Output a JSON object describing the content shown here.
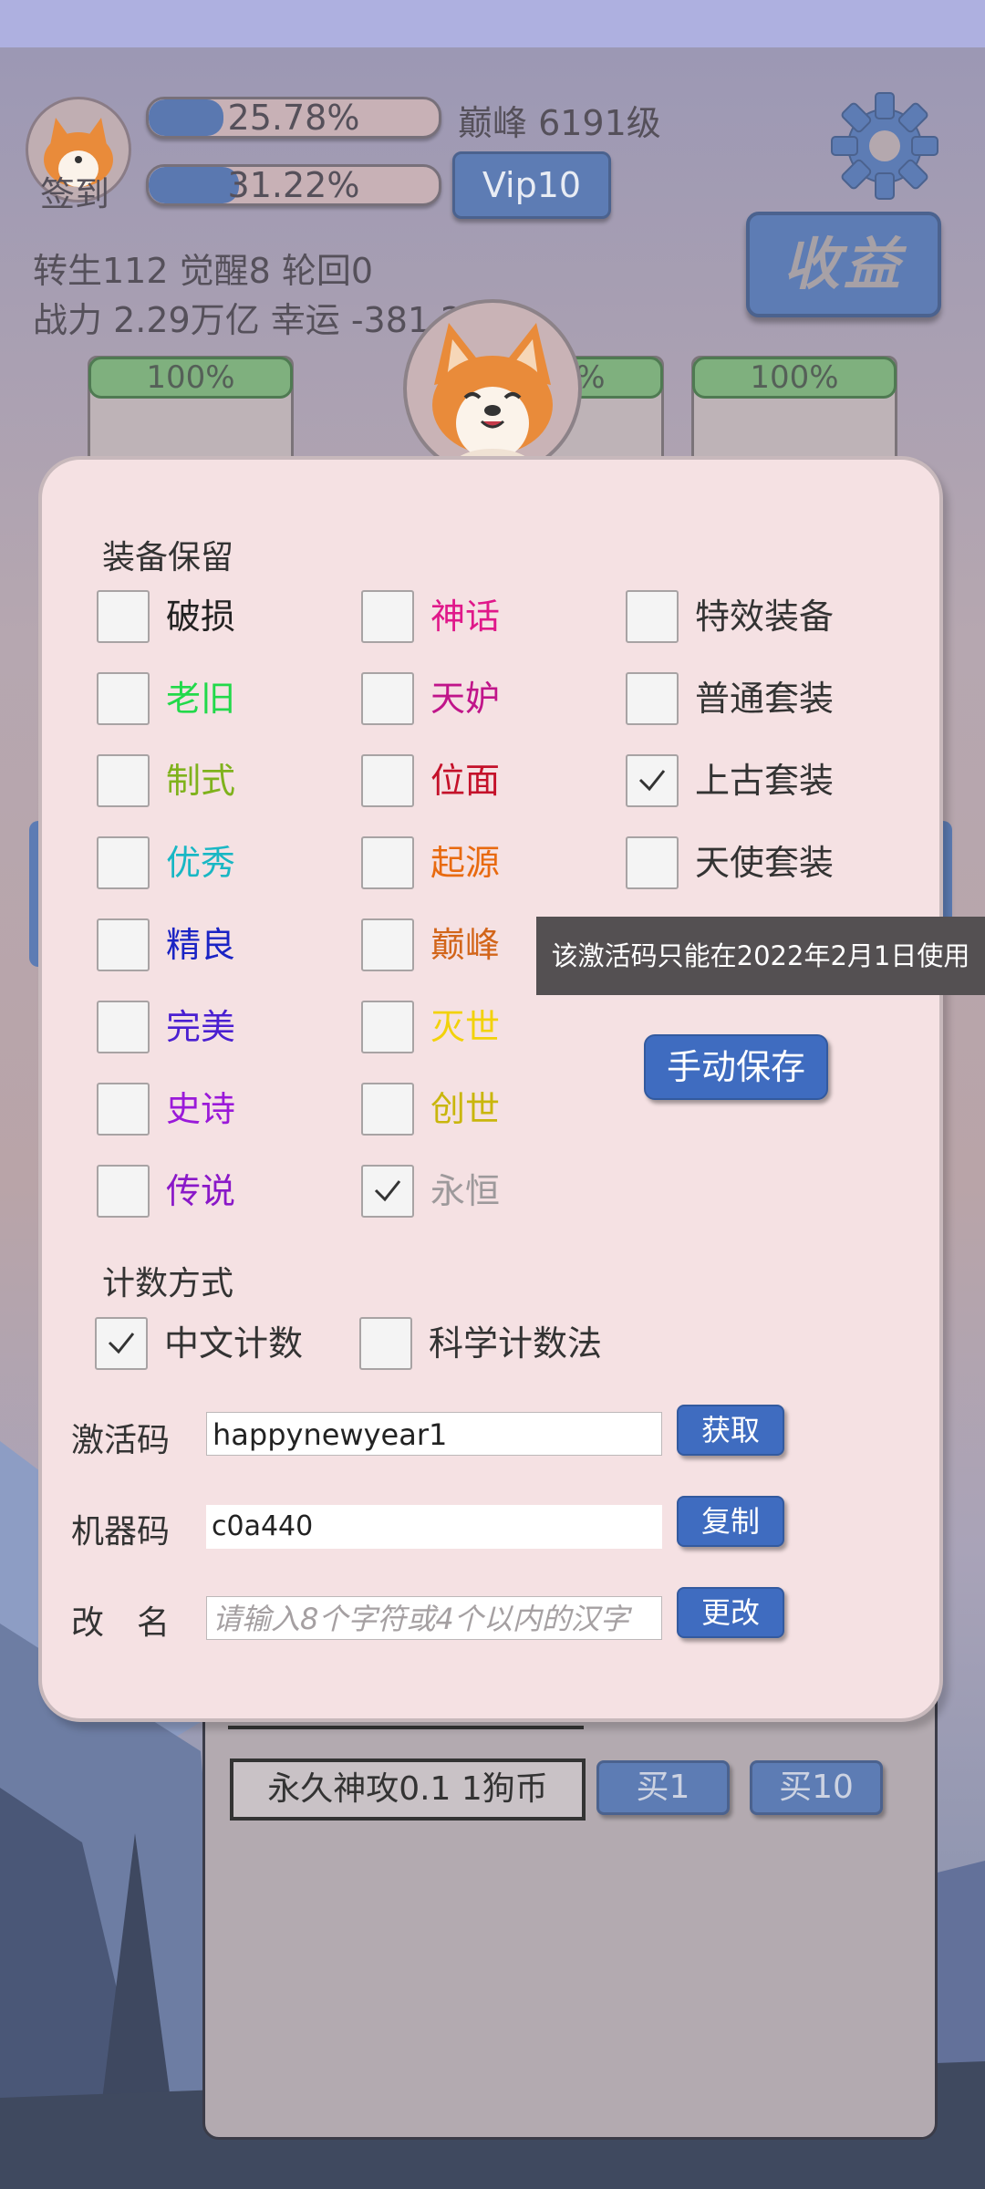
{
  "header": {
    "avatar_label": "签到",
    "bar1_text": "25.78%",
    "bar1_fill": 0.2578,
    "bar2_text": "31.22%",
    "bar2_fill": 0.3122,
    "peak_level": "巅峰 6191级",
    "vip": "Vip10",
    "income_button": "收益",
    "stats_line1": "转生112 觉醒8 轮回0",
    "stats_line2": "战力 2.29万亿  幸运 -381.2",
    "tabs": [
      "100%",
      "100%",
      "100%"
    ]
  },
  "dialog": {
    "equip_title": "装备保留",
    "options": [
      {
        "label": "破损",
        "color": "#222222",
        "checked": false
      },
      {
        "label": "神话",
        "color": "#e0188a",
        "checked": false
      },
      {
        "label": "特效装备",
        "color": "#333333",
        "checked": false
      },
      {
        "label": "老旧",
        "color": "#22d94a",
        "checked": false
      },
      {
        "label": "天妒",
        "color": "#c0158a",
        "checked": false
      },
      {
        "label": "普通套装",
        "color": "#333333",
        "checked": false
      },
      {
        "label": "制式",
        "color": "#7fb21c",
        "checked": false
      },
      {
        "label": "位面",
        "color": "#c4112a",
        "checked": false
      },
      {
        "label": "上古套装",
        "color": "#333333",
        "checked": true
      },
      {
        "label": "优秀",
        "color": "#19b7c4",
        "checked": false
      },
      {
        "label": "起源",
        "color": "#e86a10",
        "checked": false
      },
      {
        "label": "天使套装",
        "color": "#333333",
        "checked": false
      },
      {
        "label": "精良",
        "color": "#1a23c4",
        "checked": false
      },
      {
        "label": "巅峰",
        "color": "#d2651a",
        "checked": false
      },
      {
        "label": "完美",
        "color": "#4a1fd1",
        "checked": false
      },
      {
        "label": "灭世",
        "color": "#f2d20a",
        "checked": false
      },
      {
        "label": "史诗",
        "color": "#9a19d9",
        "checked": false
      },
      {
        "label": "创世",
        "color": "#c9b60c",
        "checked": false
      },
      {
        "label": "传说",
        "color": "#8a18c8",
        "checked": false
      },
      {
        "label": "永恒",
        "color": "#9d999b",
        "checked": true
      }
    ],
    "tooltip": "该激活码只能在2022年2月1日使用",
    "manual_save": "手动保存",
    "count_title": "计数方式",
    "count_options": [
      {
        "label": "中文计数",
        "checked": true
      },
      {
        "label": "科学计数法",
        "checked": false
      }
    ],
    "activation_label": "激活码",
    "activation_value": "happynewyear1",
    "activation_button": "获取",
    "machine_label": "机器码",
    "machine_value": "c0a440",
    "machine_button": "复制",
    "rename_label": "改　名",
    "rename_placeholder": "请输入8个字符或4个以内的汉字",
    "rename_button": "更改"
  },
  "shop": {
    "item": "永久神攻0.1 1狗币",
    "buy1": "买1",
    "buy10": "买10"
  }
}
